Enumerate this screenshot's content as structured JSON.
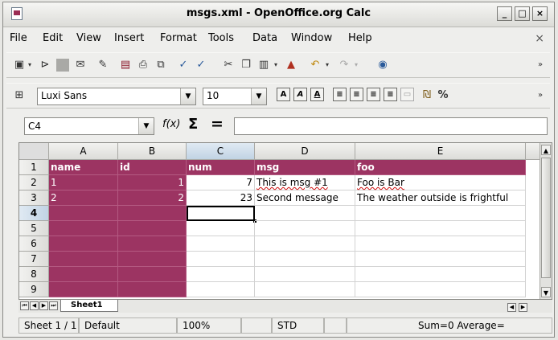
{
  "window": {
    "title": "msgs.xml - OpenOffice.org Calc",
    "buttons": [
      "_",
      "□",
      "×"
    ]
  },
  "menubar": {
    "items": [
      "File",
      "Edit",
      "View",
      "Insert",
      "Format",
      "Tools",
      "Data",
      "Window",
      "Help"
    ],
    "close": "×"
  },
  "format_toolbar": {
    "font_name": "Luxi Sans",
    "font_size": "10",
    "bold": "A",
    "italic": "A",
    "underline": "A",
    "percent": "%"
  },
  "formula_bar": {
    "cell_ref": "C4",
    "function_wizard": "f(x)",
    "sum": "Σ",
    "equals": "=",
    "content": ""
  },
  "sheet": {
    "columns": [
      "A",
      "B",
      "C",
      "D",
      "E"
    ],
    "rows": [
      "1",
      "2",
      "3",
      "4",
      "5",
      "6",
      "7",
      "8",
      "9"
    ],
    "selected_column": "C",
    "selected_row": "4",
    "cells": {
      "A1": "name",
      "B1": "id",
      "C1": "num",
      "D1": "msg",
      "E1": "foo",
      "A2": "1",
      "B2": "1",
      "C2": "7",
      "D2": "This is msg #1",
      "E2": "Foo is Bar",
      "A3": "2",
      "B3": "2",
      "C3": "23",
      "D3": "Second message",
      "E3": "The weather outside is frightful"
    },
    "highlight_color": "#9c3462"
  },
  "tabs": {
    "sheet_name": "Sheet1"
  },
  "statusbar": {
    "sheet": "Sheet 1 / 1",
    "style": "Default",
    "zoom": "100%",
    "mode": "STD",
    "summary": "Sum=0 Average="
  }
}
